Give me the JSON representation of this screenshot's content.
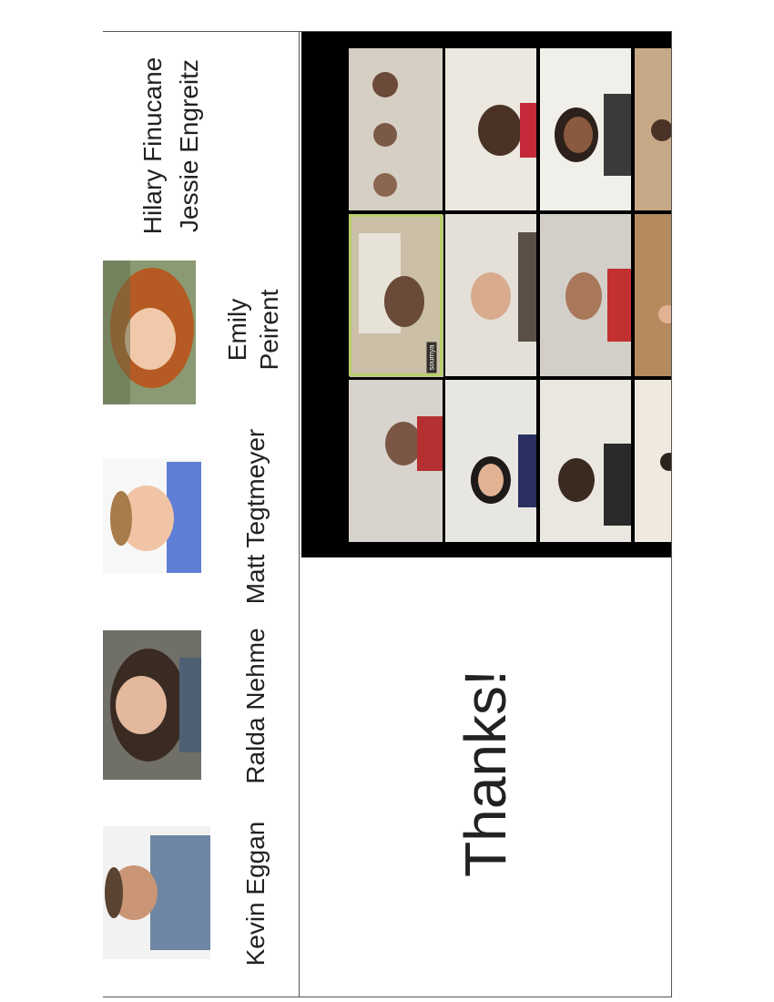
{
  "people": [
    {
      "name": "Kevin Eggan",
      "icon": "person-photo"
    },
    {
      "name": "Ralda Nehme",
      "icon": "person-photo"
    },
    {
      "name": "Matt Tegtmeyer",
      "icon": "person-photo"
    },
    {
      "name_line1": "Emily",
      "name_line2": "Peirent",
      "icon": "person-photo"
    },
    {
      "name_line1": "Hilary Finucane",
      "name_line2": "Jessie Engreitz"
    }
  ],
  "closing_text": "Thanks!",
  "video_grid": {
    "active_tile_label": "soumya",
    "active_border_color": "#b8cf6a"
  }
}
